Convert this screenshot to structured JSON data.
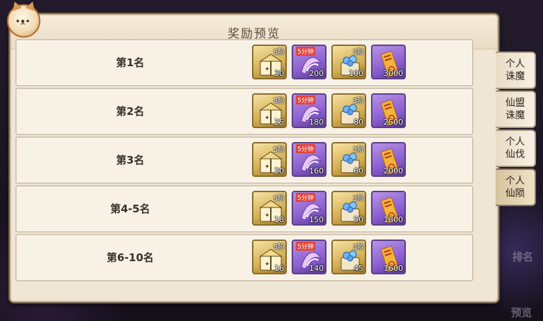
{
  "background_labels": {
    "rank_btn": "排名",
    "preview_btn": "预览"
  },
  "panel": {
    "title": "奖励预览"
  },
  "tabs": [
    {
      "label": "个人\n诛魔",
      "active": false
    },
    {
      "label": "仙盟\n诛魔",
      "active": false
    },
    {
      "label": "个人\n仙伐",
      "active": false
    },
    {
      "label": "个人\n仙陨",
      "active": true
    }
  ],
  "rewards": [
    {
      "rank": "第1名",
      "items": [
        {
          "icon": "chest-icon",
          "tier": "5阶",
          "count": "30"
        },
        {
          "icon": "scroll-icon",
          "tier": "5分钟",
          "count": "200"
        },
        {
          "icon": "crystal-chest-icon",
          "tier": "3阶",
          "count": "100"
        },
        {
          "icon": "talisman-icon",
          "tier": "",
          "count": "3000"
        }
      ]
    },
    {
      "rank": "第2名",
      "items": [
        {
          "icon": "chest-icon",
          "tier": "5阶",
          "count": "25"
        },
        {
          "icon": "scroll-icon",
          "tier": "5分钟",
          "count": "180"
        },
        {
          "icon": "crystal-chest-icon",
          "tier": "3阶",
          "count": "80"
        },
        {
          "icon": "talisman-icon",
          "tier": "",
          "count": "2500"
        }
      ]
    },
    {
      "rank": "第3名",
      "items": [
        {
          "icon": "chest-icon",
          "tier": "5阶",
          "count": "20"
        },
        {
          "icon": "scroll-icon",
          "tier": "5分钟",
          "count": "160"
        },
        {
          "icon": "crystal-chest-icon",
          "tier": "3阶",
          "count": "60"
        },
        {
          "icon": "talisman-icon",
          "tier": "",
          "count": "2000"
        }
      ]
    },
    {
      "rank": "第4-5名",
      "items": [
        {
          "icon": "chest-icon",
          "tier": "5阶",
          "count": "18"
        },
        {
          "icon": "scroll-icon",
          "tier": "5分钟",
          "count": "150"
        },
        {
          "icon": "crystal-chest-icon",
          "tier": "3阶",
          "count": "50"
        },
        {
          "icon": "talisman-icon",
          "tier": "",
          "count": "1800"
        }
      ]
    },
    {
      "rank": "第6-10名",
      "items": [
        {
          "icon": "chest-icon",
          "tier": "5阶",
          "count": "16"
        },
        {
          "icon": "scroll-icon",
          "tier": "5分钟",
          "count": "140"
        },
        {
          "icon": "crystal-chest-icon",
          "tier": "3阶",
          "count": "45"
        },
        {
          "icon": "talisman-icon",
          "tier": "",
          "count": "1600"
        }
      ]
    }
  ]
}
